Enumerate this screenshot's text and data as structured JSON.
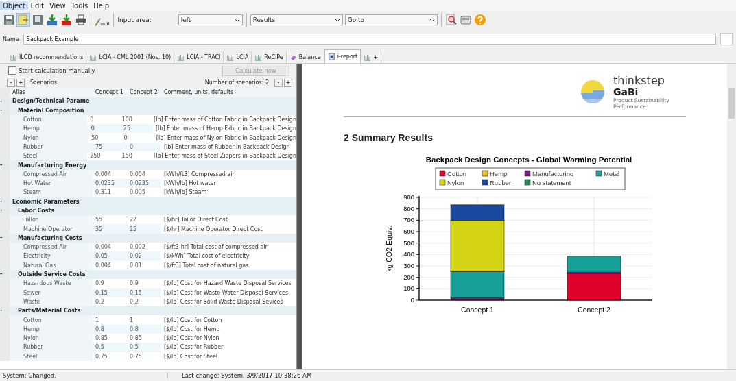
{
  "menu": [
    {
      "label": "Object",
      "selected": true
    },
    {
      "label": "Edit",
      "selected": false
    },
    {
      "label": "View",
      "selected": false
    },
    {
      "label": "Tools",
      "selected": false
    },
    {
      "label": "Help",
      "selected": false
    }
  ],
  "toolbar": {
    "edit_label": "edit",
    "input_area_label": "Input area:",
    "input_area": "left",
    "view": "Results",
    "goto": "Go to"
  },
  "name_field": {
    "label": "Name",
    "value": "Backpack Example"
  },
  "tabs": [
    {
      "label": "ILCD recommendations",
      "kind": "chart",
      "selected": false
    },
    {
      "label": "LCIA - CML 2001 (Nov. 10)",
      "kind": "chart",
      "selected": false
    },
    {
      "label": "LCIA - TRACI",
      "kind": "chart",
      "selected": false
    },
    {
      "label": "LCIA",
      "kind": "chart",
      "selected": false
    },
    {
      "label": "ReCiPe",
      "kind": "chart",
      "selected": false
    },
    {
      "label": "Balance",
      "kind": "balance",
      "selected": false
    },
    {
      "label": "i-report",
      "kind": "report",
      "selected": true
    },
    {
      "label": "+",
      "kind": "chart",
      "selected": false
    }
  ],
  "calc": {
    "manual_label": "Start calculation manually",
    "manual_checked": false,
    "button": "Calculate now",
    "button_disabled": true
  },
  "scenarios": {
    "collapse": "-",
    "expand": "+",
    "label": "Scenarios",
    "count_label": "Number of scenarios: 2",
    "minus": "-",
    "plus": "+"
  },
  "table": {
    "columns": [
      "Alias",
      "Concept 1",
      "Concept 2",
      "Comment, units, defaults"
    ],
    "groups": [
      {
        "toggle": "-",
        "label": "Design/Technical Parame",
        "children": [
          {
            "toggle": "-",
            "label": "Material Composition",
            "rows": [
              [
                "Cotton",
                "0",
                "100",
                "[lb] Enter mass of Cotton Fabric in Backpack Design"
              ],
              [
                "Hemp",
                "0",
                "25",
                "[lb] Enter mass of Hemp Fabric in Backpack Design"
              ],
              [
                "Nylon",
                "50",
                "0",
                "[lb] Enter mass of Nylon Fabric in Backpack Design"
              ],
              [
                "Rubber",
                "75",
                "0",
                "[lb] Enter mass of Rubber in Backpack Design"
              ],
              [
                "Steel",
                "250",
                "150",
                "[lb] Enter mass of Steel Zippers in Backpack Design"
              ]
            ]
          },
          {
            "toggle": "-",
            "label": "Manufacturing Energy",
            "rows": [
              [
                "Compressed Air",
                "0.004",
                "0.004",
                "[kWh/ft3] Compressed air"
              ],
              [
                "Hot Water",
                "0.0235",
                "0.0235",
                "[kWh/lb] Hot water"
              ],
              [
                "Steam",
                "0.311",
                "0.005",
                "[kWh/lb] Steam"
              ]
            ]
          }
        ]
      },
      {
        "toggle": "-",
        "label": "Economic Parameters",
        "children": [
          {
            "toggle": "-",
            "label": "Labor Costs",
            "rows": [
              [
                "Tailor",
                "55",
                "22",
                "[$/hr] Tailor Direct Cost"
              ],
              [
                "Machine Operator",
                "35",
                "25",
                "[$/hr] Machine Operator Direct Cost"
              ]
            ]
          },
          {
            "toggle": "-",
            "label": "Manufacturing Costs",
            "rows": [
              [
                "Compressed Air",
                "0.004",
                "0.002",
                "[$/ft3-hr] Total cost of compressed air"
              ],
              [
                "Electricity",
                "0.05",
                "0.02",
                "[$/kWh] Total cost of electricity"
              ],
              [
                "Natural Gas",
                "0.004",
                "0.01",
                "[$/ft3] Total cost of natural gas"
              ]
            ]
          },
          {
            "toggle": "-",
            "label": "Outside Service Costs",
            "rows": [
              [
                "Hazardous Waste",
                "0.9",
                "0.9",
                "[$/lb] Cost for Hazard Waste Disposal Services"
              ],
              [
                "Sewer",
                "0.15",
                "0.15",
                "[$/lb] Cost for Waste Water Disposal Services"
              ],
              [
                "Waste",
                "0.2",
                "0.2",
                "[$/lb] Cost for Solid Waste Disposal Sevices"
              ]
            ]
          },
          {
            "toggle": "-",
            "label": "Parts/Material Costs",
            "rows": [
              [
                "Cotton",
                "1",
                "1",
                "[$/lb] Cost for Cotton"
              ],
              [
                "Hemp",
                "0.8",
                "0.8",
                "[$/lb] Cost for Hemp"
              ],
              [
                "Nylon",
                "0.85",
                "0.85",
                "[$/lb] Cost for Nylon"
              ],
              [
                "Rubber",
                "0.5",
                "0.5",
                "[$/lb] Cost for Rubber"
              ],
              [
                "Steel",
                "0.75",
                "0.75",
                "[$/lb] Cost for Steel"
              ]
            ]
          }
        ]
      }
    ]
  },
  "report": {
    "brand": "thinkstep",
    "product": "GaBi",
    "tagline": "Product Sustainability Performance",
    "heading": "2 Summary Results",
    "chart_data": {
      "type": "bar",
      "stacked": true,
      "grid": true,
      "legend": true,
      "title": "Backpack Design Concepts - Global Warming Potential",
      "ylabel": "kg CO2-Equiv.",
      "categories": [
        "Concept 1",
        "Concept 2"
      ],
      "ylim": [
        0,
        900
      ],
      "yticks": [
        0,
        100,
        200,
        300,
        400,
        500,
        600,
        700,
        800,
        900
      ],
      "series": [
        {
          "name": "Cotton",
          "color": "#e0002a",
          "values": [
            0,
            230
          ]
        },
        {
          "name": "Nylon",
          "color": "#d4d414",
          "values": [
            450,
            0
          ]
        },
        {
          "name": "Hemp",
          "color": "#f0c020",
          "values": [
            0,
            0
          ]
        },
        {
          "name": "Rubber",
          "color": "#1a4aa0",
          "values": [
            135,
            0
          ]
        },
        {
          "name": "Manufacturing",
          "color": "#7a1a7a",
          "values": [
            20,
            15
          ]
        },
        {
          "name": "No statement",
          "color": "#1a8a5a",
          "values": [
            0,
            0
          ]
        },
        {
          "name": "Metal",
          "color": "#16a098",
          "values": [
            230,
            140
          ]
        }
      ]
    }
  },
  "status_bar": [
    "System: Changed.",
    "Last change: System, 3/9/2017 10:38:26 AM"
  ]
}
